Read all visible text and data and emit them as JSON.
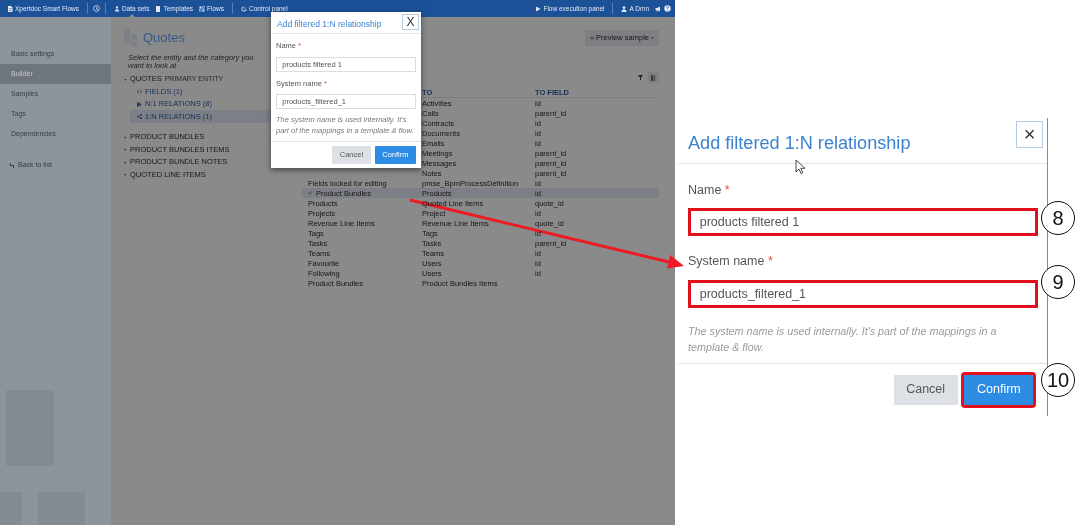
{
  "navbar": {
    "brand": "Xpertdoc Smart Flows",
    "items": [
      {
        "label": "Data sets",
        "selected": true
      },
      {
        "label": "Templates",
        "selected": false
      },
      {
        "label": "Flows",
        "selected": false
      },
      {
        "label": "Control panel",
        "selected": false
      }
    ],
    "execution_panel": "Flow execution panel",
    "user": "A Dmn"
  },
  "sidebar": {
    "items": [
      {
        "label": "Basic settings",
        "selected": false
      },
      {
        "label": "Builder",
        "selected": true
      },
      {
        "label": "Samples",
        "selected": false
      },
      {
        "label": "Tags",
        "selected": false
      },
      {
        "label": "Dependencies",
        "selected": false
      }
    ],
    "back_link": "Back to list"
  },
  "page": {
    "title": "Quotes",
    "subtitle": "Select the entity and the category you want to look at",
    "preview_button": "Preview sample",
    "tree": [
      {
        "label": "QUOTES",
        "tag": "PRIMARY ENTITY",
        "expanded": true,
        "children": [
          {
            "label": "FIELDS (1)",
            "kind": "fields",
            "selected": false
          },
          {
            "label": "N:1 RELATIONS (8)",
            "kind": "many-to-one",
            "selected": false
          },
          {
            "label": "1:N RELATIONS (1)",
            "kind": "one-to-many",
            "selected": true
          }
        ]
      },
      {
        "label": "PRODUCT BUNDLES",
        "expanded": false
      },
      {
        "label": "PRODUCT BUNDLES ITEMS",
        "expanded": false
      },
      {
        "label": "PRODUCT BUNDLE NOTES",
        "expanded": false
      },
      {
        "label": "QUOTED LINE ITEMS",
        "expanded": false
      }
    ]
  },
  "table": {
    "columns": [
      "TO",
      "TO FIELD"
    ],
    "rows": [
      {
        "to": "Activities",
        "to_field": "id",
        "selected": false
      },
      {
        "to": "Calls",
        "to_field": "parent_id",
        "selected": false
      },
      {
        "to": "Contracts",
        "to_field": "id",
        "selected": false
      },
      {
        "to": "Documents",
        "to_field": "id",
        "selected": false
      },
      {
        "to": "Emails",
        "to_field": "id",
        "selected": false
      },
      {
        "to": "Meetings",
        "to_field": "parent_id",
        "selected": false
      },
      {
        "to": "Messages",
        "to_field": "parent_id",
        "selected": false
      },
      {
        "to": "Notes",
        "to_field": "parent_id",
        "selected": false
      },
      {
        "from": "Fields locked for editing",
        "to": "pmse_BpmProcessDefinition",
        "to_field": "id",
        "selected": false
      },
      {
        "from": "Product Bundles",
        "to": "Products",
        "to_field": "id",
        "selected": true
      },
      {
        "from": "Products",
        "to": "Quoted Line Items",
        "to_field": "quote_id",
        "selected": false
      },
      {
        "from": "Projects",
        "to": "Project",
        "to_field": "id",
        "selected": false
      },
      {
        "from": "Revenue Line Items",
        "to": "Revenue Line Items",
        "to_field": "quote_id",
        "selected": false
      },
      {
        "from": "Tags",
        "to": "Tags",
        "to_field": "id",
        "selected": false
      },
      {
        "from": "Tasks",
        "to": "Tasks",
        "to_field": "parent_id",
        "selected": false
      },
      {
        "from": "Teams",
        "to": "Teams",
        "to_field": "id",
        "selected": false
      },
      {
        "from": "Favourite",
        "to": "Users",
        "to_field": "id",
        "selected": false
      },
      {
        "from": "Following",
        "to": "Users",
        "to_field": "id",
        "selected": false
      },
      {
        "from": "Product Bundles",
        "to": "Product Bundles Items",
        "selected": false
      }
    ]
  },
  "dialog": {
    "title": "Add filtered 1:N relationship",
    "close": "X",
    "fields": [
      {
        "label": "Name",
        "required_mark": "*",
        "value": "products filtered 1",
        "highlighted": false
      },
      {
        "label": "System name",
        "required_mark": "*",
        "value": "products_filtered_1",
        "highlighted": false
      }
    ],
    "help": "The system name is used internally. It's part of the mappings in a template & flow.",
    "buttons": [
      {
        "label": "Cancel",
        "kind": "secondary",
        "highlighted": false
      },
      {
        "label": "Confirm",
        "kind": "primary",
        "highlighted": false
      }
    ]
  },
  "dialog_zoom": {
    "title": "Add filtered 1:N relationship",
    "close": "×",
    "fields": [
      {
        "label": "Name",
        "required_mark": "*",
        "value": "products filtered 1",
        "highlighted": true
      },
      {
        "label": "System name",
        "required_mark": "*",
        "value": "products_filtered_1",
        "highlighted": true
      }
    ],
    "help": "The system name is used internally. It's part of the mappings in a template & flow.",
    "buttons": [
      {
        "label": "Cancel",
        "kind": "secondary",
        "highlighted": false
      },
      {
        "label": "Confirm",
        "kind": "primary",
        "highlighted": true
      }
    ]
  },
  "callouts": [
    "8",
    "9",
    "10"
  ]
}
